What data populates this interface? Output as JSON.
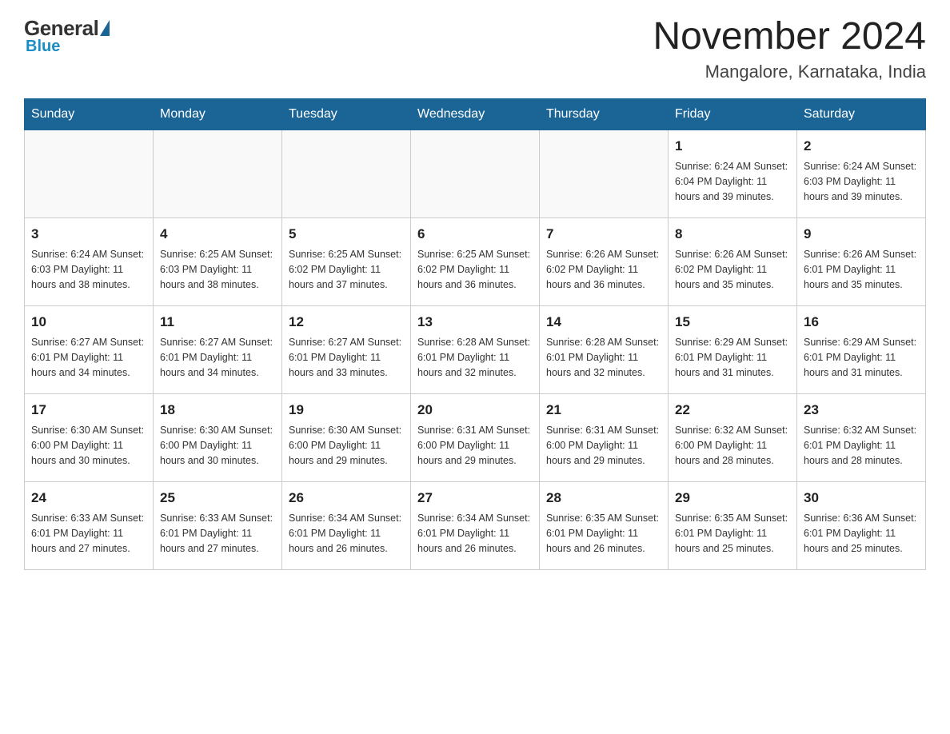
{
  "logo": {
    "general": "General",
    "blue": "Blue"
  },
  "title": "November 2024",
  "location": "Mangalore, Karnataka, India",
  "days_of_week": [
    "Sunday",
    "Monday",
    "Tuesday",
    "Wednesday",
    "Thursday",
    "Friday",
    "Saturday"
  ],
  "weeks": [
    [
      {
        "day": "",
        "info": ""
      },
      {
        "day": "",
        "info": ""
      },
      {
        "day": "",
        "info": ""
      },
      {
        "day": "",
        "info": ""
      },
      {
        "day": "",
        "info": ""
      },
      {
        "day": "1",
        "info": "Sunrise: 6:24 AM\nSunset: 6:04 PM\nDaylight: 11 hours and 39 minutes."
      },
      {
        "day": "2",
        "info": "Sunrise: 6:24 AM\nSunset: 6:03 PM\nDaylight: 11 hours and 39 minutes."
      }
    ],
    [
      {
        "day": "3",
        "info": "Sunrise: 6:24 AM\nSunset: 6:03 PM\nDaylight: 11 hours and 38 minutes."
      },
      {
        "day": "4",
        "info": "Sunrise: 6:25 AM\nSunset: 6:03 PM\nDaylight: 11 hours and 38 minutes."
      },
      {
        "day": "5",
        "info": "Sunrise: 6:25 AM\nSunset: 6:02 PM\nDaylight: 11 hours and 37 minutes."
      },
      {
        "day": "6",
        "info": "Sunrise: 6:25 AM\nSunset: 6:02 PM\nDaylight: 11 hours and 36 minutes."
      },
      {
        "day": "7",
        "info": "Sunrise: 6:26 AM\nSunset: 6:02 PM\nDaylight: 11 hours and 36 minutes."
      },
      {
        "day": "8",
        "info": "Sunrise: 6:26 AM\nSunset: 6:02 PM\nDaylight: 11 hours and 35 minutes."
      },
      {
        "day": "9",
        "info": "Sunrise: 6:26 AM\nSunset: 6:01 PM\nDaylight: 11 hours and 35 minutes."
      }
    ],
    [
      {
        "day": "10",
        "info": "Sunrise: 6:27 AM\nSunset: 6:01 PM\nDaylight: 11 hours and 34 minutes."
      },
      {
        "day": "11",
        "info": "Sunrise: 6:27 AM\nSunset: 6:01 PM\nDaylight: 11 hours and 34 minutes."
      },
      {
        "day": "12",
        "info": "Sunrise: 6:27 AM\nSunset: 6:01 PM\nDaylight: 11 hours and 33 minutes."
      },
      {
        "day": "13",
        "info": "Sunrise: 6:28 AM\nSunset: 6:01 PM\nDaylight: 11 hours and 32 minutes."
      },
      {
        "day": "14",
        "info": "Sunrise: 6:28 AM\nSunset: 6:01 PM\nDaylight: 11 hours and 32 minutes."
      },
      {
        "day": "15",
        "info": "Sunrise: 6:29 AM\nSunset: 6:01 PM\nDaylight: 11 hours and 31 minutes."
      },
      {
        "day": "16",
        "info": "Sunrise: 6:29 AM\nSunset: 6:01 PM\nDaylight: 11 hours and 31 minutes."
      }
    ],
    [
      {
        "day": "17",
        "info": "Sunrise: 6:30 AM\nSunset: 6:00 PM\nDaylight: 11 hours and 30 minutes."
      },
      {
        "day": "18",
        "info": "Sunrise: 6:30 AM\nSunset: 6:00 PM\nDaylight: 11 hours and 30 minutes."
      },
      {
        "day": "19",
        "info": "Sunrise: 6:30 AM\nSunset: 6:00 PM\nDaylight: 11 hours and 29 minutes."
      },
      {
        "day": "20",
        "info": "Sunrise: 6:31 AM\nSunset: 6:00 PM\nDaylight: 11 hours and 29 minutes."
      },
      {
        "day": "21",
        "info": "Sunrise: 6:31 AM\nSunset: 6:00 PM\nDaylight: 11 hours and 29 minutes."
      },
      {
        "day": "22",
        "info": "Sunrise: 6:32 AM\nSunset: 6:00 PM\nDaylight: 11 hours and 28 minutes."
      },
      {
        "day": "23",
        "info": "Sunrise: 6:32 AM\nSunset: 6:01 PM\nDaylight: 11 hours and 28 minutes."
      }
    ],
    [
      {
        "day": "24",
        "info": "Sunrise: 6:33 AM\nSunset: 6:01 PM\nDaylight: 11 hours and 27 minutes."
      },
      {
        "day": "25",
        "info": "Sunrise: 6:33 AM\nSunset: 6:01 PM\nDaylight: 11 hours and 27 minutes."
      },
      {
        "day": "26",
        "info": "Sunrise: 6:34 AM\nSunset: 6:01 PM\nDaylight: 11 hours and 26 minutes."
      },
      {
        "day": "27",
        "info": "Sunrise: 6:34 AM\nSunset: 6:01 PM\nDaylight: 11 hours and 26 minutes."
      },
      {
        "day": "28",
        "info": "Sunrise: 6:35 AM\nSunset: 6:01 PM\nDaylight: 11 hours and 26 minutes."
      },
      {
        "day": "29",
        "info": "Sunrise: 6:35 AM\nSunset: 6:01 PM\nDaylight: 11 hours and 25 minutes."
      },
      {
        "day": "30",
        "info": "Sunrise: 6:36 AM\nSunset: 6:01 PM\nDaylight: 11 hours and 25 minutes."
      }
    ]
  ]
}
